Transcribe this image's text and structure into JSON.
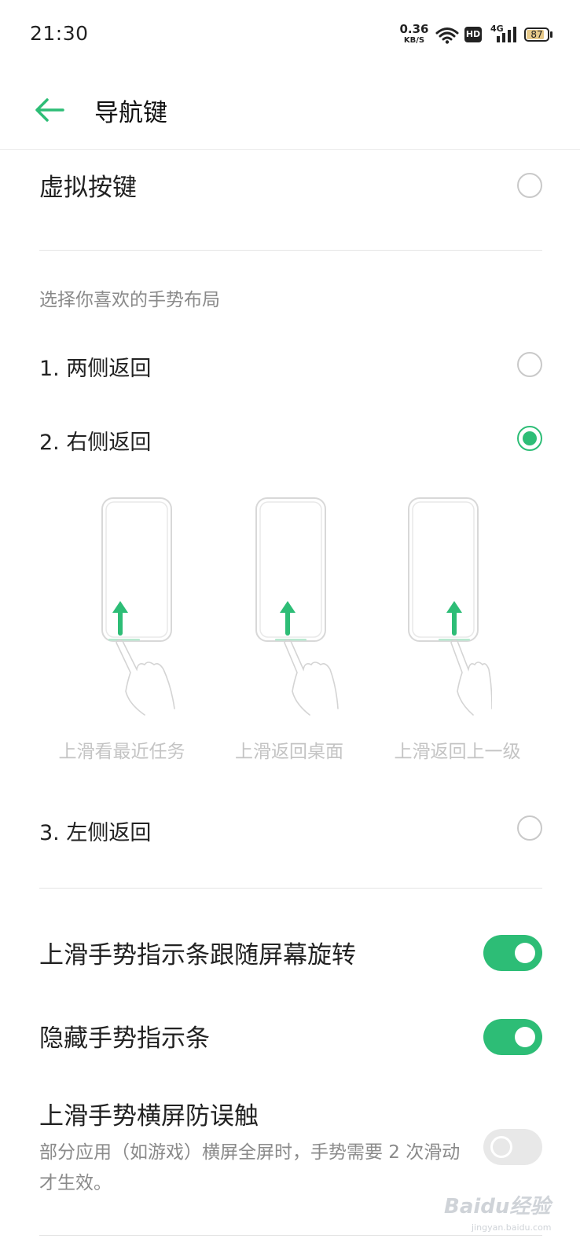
{
  "status_bar": {
    "time": "21:30",
    "net_speed_value": "0.36",
    "net_speed_unit": "KB/S",
    "hd_label": "HD",
    "network_type": "4G",
    "battery": "87"
  },
  "header": {
    "title": "导航键"
  },
  "options": {
    "virtual_keys": {
      "label": "虚拟按键",
      "selected": false
    },
    "section_label": "选择你喜欢的手势布局",
    "gesture_1": {
      "label": "1. 两侧返回",
      "selected": false
    },
    "gesture_2": {
      "label": "2. 右侧返回",
      "selected": true
    },
    "gesture_3": {
      "label": "3. 左侧返回",
      "selected": false
    }
  },
  "illustrations": [
    {
      "caption": "上滑看最近任务"
    },
    {
      "caption": "上滑返回桌面"
    },
    {
      "caption": "上滑返回上一级"
    }
  ],
  "settings": {
    "rotate": {
      "label": "上滑手势指示条跟随屏幕旋转",
      "on": true
    },
    "hide": {
      "label": "隐藏手势指示条",
      "on": true
    },
    "landscape": {
      "label": "上滑手势横屏防误触",
      "description": "部分应用（如游戏）横屏全屏时，手势需要 2 次滑动才生效。",
      "on": false
    }
  },
  "watermark": {
    "text": "Baidu经验",
    "sub": "jingyan.baidu.com"
  },
  "colors": {
    "accent": "#2dbd76",
    "text": "#222222",
    "secondary": "#8a8a8a"
  }
}
